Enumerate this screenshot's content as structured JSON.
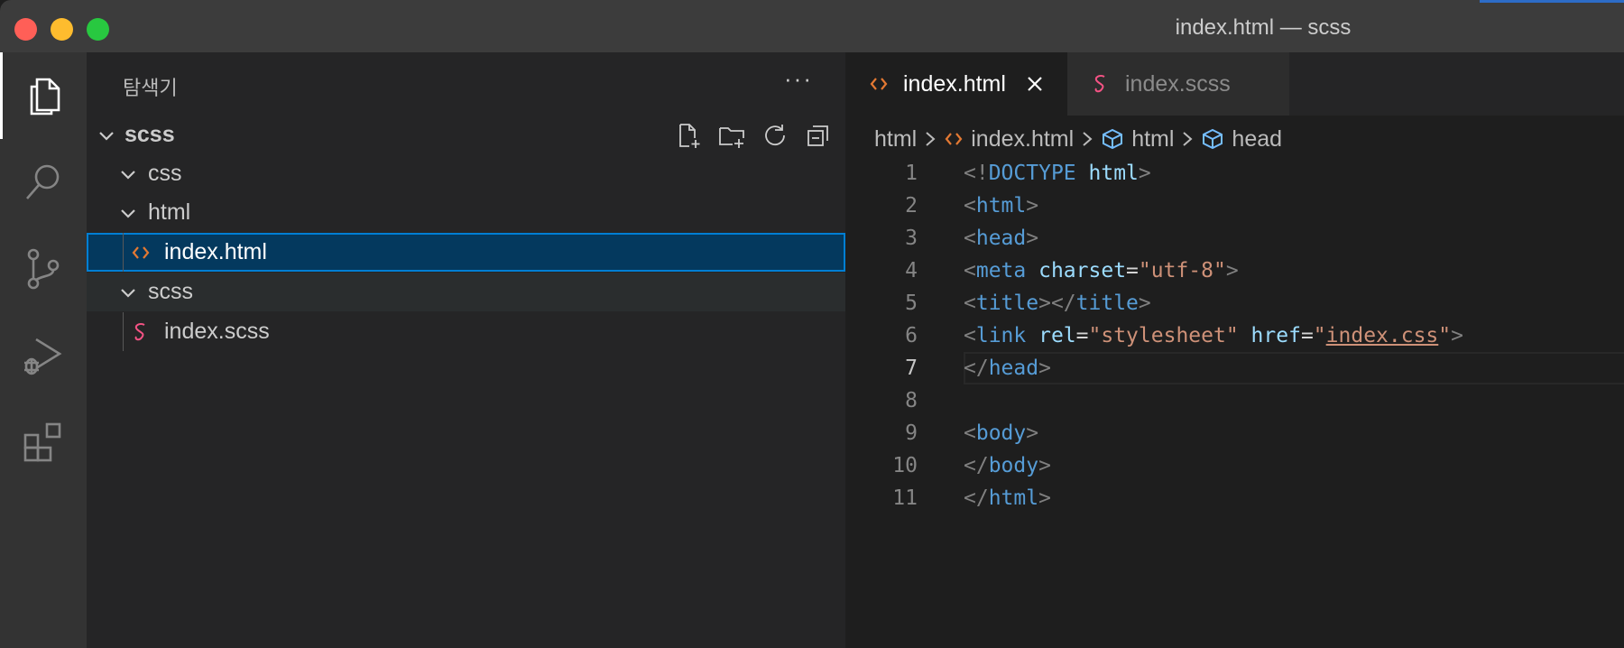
{
  "window": {
    "title": "index.html — scss"
  },
  "colors": {
    "accent": "#007fd4",
    "html_icon": "#e37933",
    "scss_icon": "#f55385",
    "tag": "#569cd6",
    "attr": "#9cdcfe",
    "string": "#ce9178"
  },
  "activity_bar": {
    "items": [
      {
        "name": "explorer",
        "icon": "files-icon",
        "active": true
      },
      {
        "name": "search",
        "icon": "search-icon",
        "active": false
      },
      {
        "name": "source-control",
        "icon": "source-control-icon",
        "active": false
      },
      {
        "name": "run-debug",
        "icon": "run-debug-icon",
        "active": false
      },
      {
        "name": "extensions",
        "icon": "extensions-icon",
        "active": false
      }
    ]
  },
  "sidebar": {
    "title": "탐색기",
    "more": "···",
    "root": "scss",
    "actions": [
      "new-file-icon",
      "new-folder-icon",
      "refresh-icon",
      "collapse-all-icon"
    ],
    "tree": [
      {
        "label": "css",
        "type": "folder",
        "expanded": true
      },
      {
        "label": "html",
        "type": "folder",
        "expanded": true
      },
      {
        "label": "index.html",
        "type": "file",
        "icon": "html-file-icon",
        "selected": true
      },
      {
        "label": "scss",
        "type": "folder",
        "expanded": true
      },
      {
        "label": "index.scss",
        "type": "file",
        "icon": "scss-file-icon"
      }
    ]
  },
  "editor": {
    "tabs": [
      {
        "label": "index.html",
        "icon": "html-file-icon",
        "active": true
      },
      {
        "label": "index.scss",
        "icon": "scss-file-icon",
        "active": false
      }
    ],
    "breadcrumb": [
      "html",
      "index.html",
      "html",
      "head"
    ],
    "current_line": 7,
    "line_numbers": [
      "1",
      "2",
      "3",
      "4",
      "5",
      "6",
      "7",
      "8",
      "9",
      "10",
      "11"
    ],
    "code": {
      "l1": {
        "lt": "<!",
        "kw": "DOCTYPE",
        "attr": "html",
        "gt": ">"
      },
      "l2": {
        "lt": "<",
        "tag": "html",
        "gt": ">"
      },
      "l3": {
        "lt": "<",
        "tag": "head",
        "gt": ">"
      },
      "l4": {
        "lt": "<",
        "tag": "meta",
        "attr": "charset",
        "eq": "=",
        "val": "\"utf-8\"",
        "gt": ">"
      },
      "l5": {
        "lt": "<",
        "tag": "title",
        "mid": "></",
        "tag2": "title",
        "gt": ">"
      },
      "l6": {
        "lt": "<",
        "tag": "link",
        "attr1": "rel",
        "eq": "=",
        "val1": "\"stylesheet\"",
        "attr2": "href",
        "q1": "\"",
        "val2": "index.css",
        "q2": "\"",
        "gt": ">"
      },
      "l7": {
        "lt": "</",
        "tag": "head",
        "gt": ">"
      },
      "l9": {
        "lt": "<",
        "tag": "body",
        "gt": ">"
      },
      "l10": {
        "lt": "</",
        "tag": "body",
        "gt": ">"
      },
      "l11": {
        "lt": "</",
        "tag": "html",
        "gt": ">"
      }
    }
  }
}
